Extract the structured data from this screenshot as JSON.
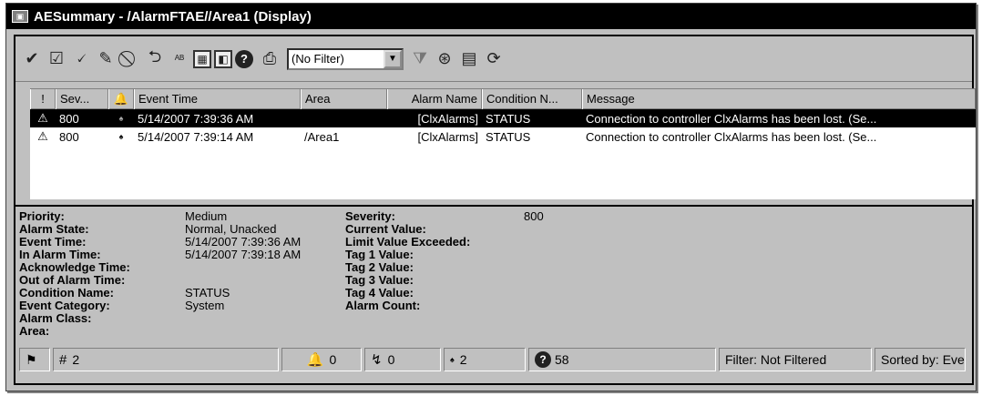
{
  "window": {
    "title": "AESummary - /AlarmFTAE//Area1 (Display)"
  },
  "toolbar": {
    "filter_value": "(No Filter)",
    "icons": [
      "check-icon",
      "check-all-icon",
      "check-page-icon",
      "silence-icon",
      "suppress-icon",
      "shelve-icon",
      "acknowledge-icon",
      "calculator-icon",
      "properties-icon",
      "help-icon",
      "print-icon",
      "filter-funnel-icon",
      "search-icon",
      "list-icon",
      "refresh-icon"
    ]
  },
  "grid": {
    "columns": [
      "!",
      "Sev...",
      "",
      "Event Time",
      "Area",
      "Alarm Name",
      "Condition N...",
      "Message"
    ],
    "rows": [
      {
        "priority_icon": "⚠",
        "severity": "800",
        "ack_icon": "♠",
        "time": "5/14/2007 7:39:36 AM",
        "area": "",
        "alarm_name": "[ClxAlarms]",
        "condition": "STATUS",
        "message": "Connection to controller ClxAlarms has been lost. (Se..."
      },
      {
        "priority_icon": "⚠",
        "severity": "800",
        "ack_icon": "♠",
        "time": "5/14/2007 7:39:14 AM",
        "area": "/Area1",
        "alarm_name": "[ClxAlarms]",
        "condition": "STATUS",
        "message": "Connection to controller ClxAlarms has been lost. (Se..."
      }
    ]
  },
  "details": {
    "left_labels": [
      "Priority:",
      "Alarm State:",
      "Event Time:",
      "In Alarm Time:",
      "Acknowledge Time:",
      "Out of Alarm Time:",
      "Condition Name:",
      "Event Category:",
      "Alarm Class:",
      "Area:"
    ],
    "left_values": [
      "Medium",
      "Normal, Unacked",
      "5/14/2007 7:39:36 AM",
      "5/14/2007 7:39:18 AM",
      "",
      "",
      "STATUS",
      "System",
      "",
      ""
    ],
    "right_labels": [
      "Severity:",
      "Current Value:",
      "Limit Value Exceeded:",
      "Tag 1 Value:",
      "Tag 2 Value:",
      "Tag 3 Value:",
      "Tag 4 Value:",
      "Alarm Count:"
    ],
    "right_values": [
      "800",
      "",
      "",
      "",
      "",
      "",
      "",
      ""
    ]
  },
  "statusbar": {
    "total": "2",
    "unacked": "0",
    "faulted": "0",
    "in_alarm": "2",
    "help_count": "58",
    "filter": "Filter: Not Filtered",
    "sorted": "Sorted by: Eve"
  }
}
